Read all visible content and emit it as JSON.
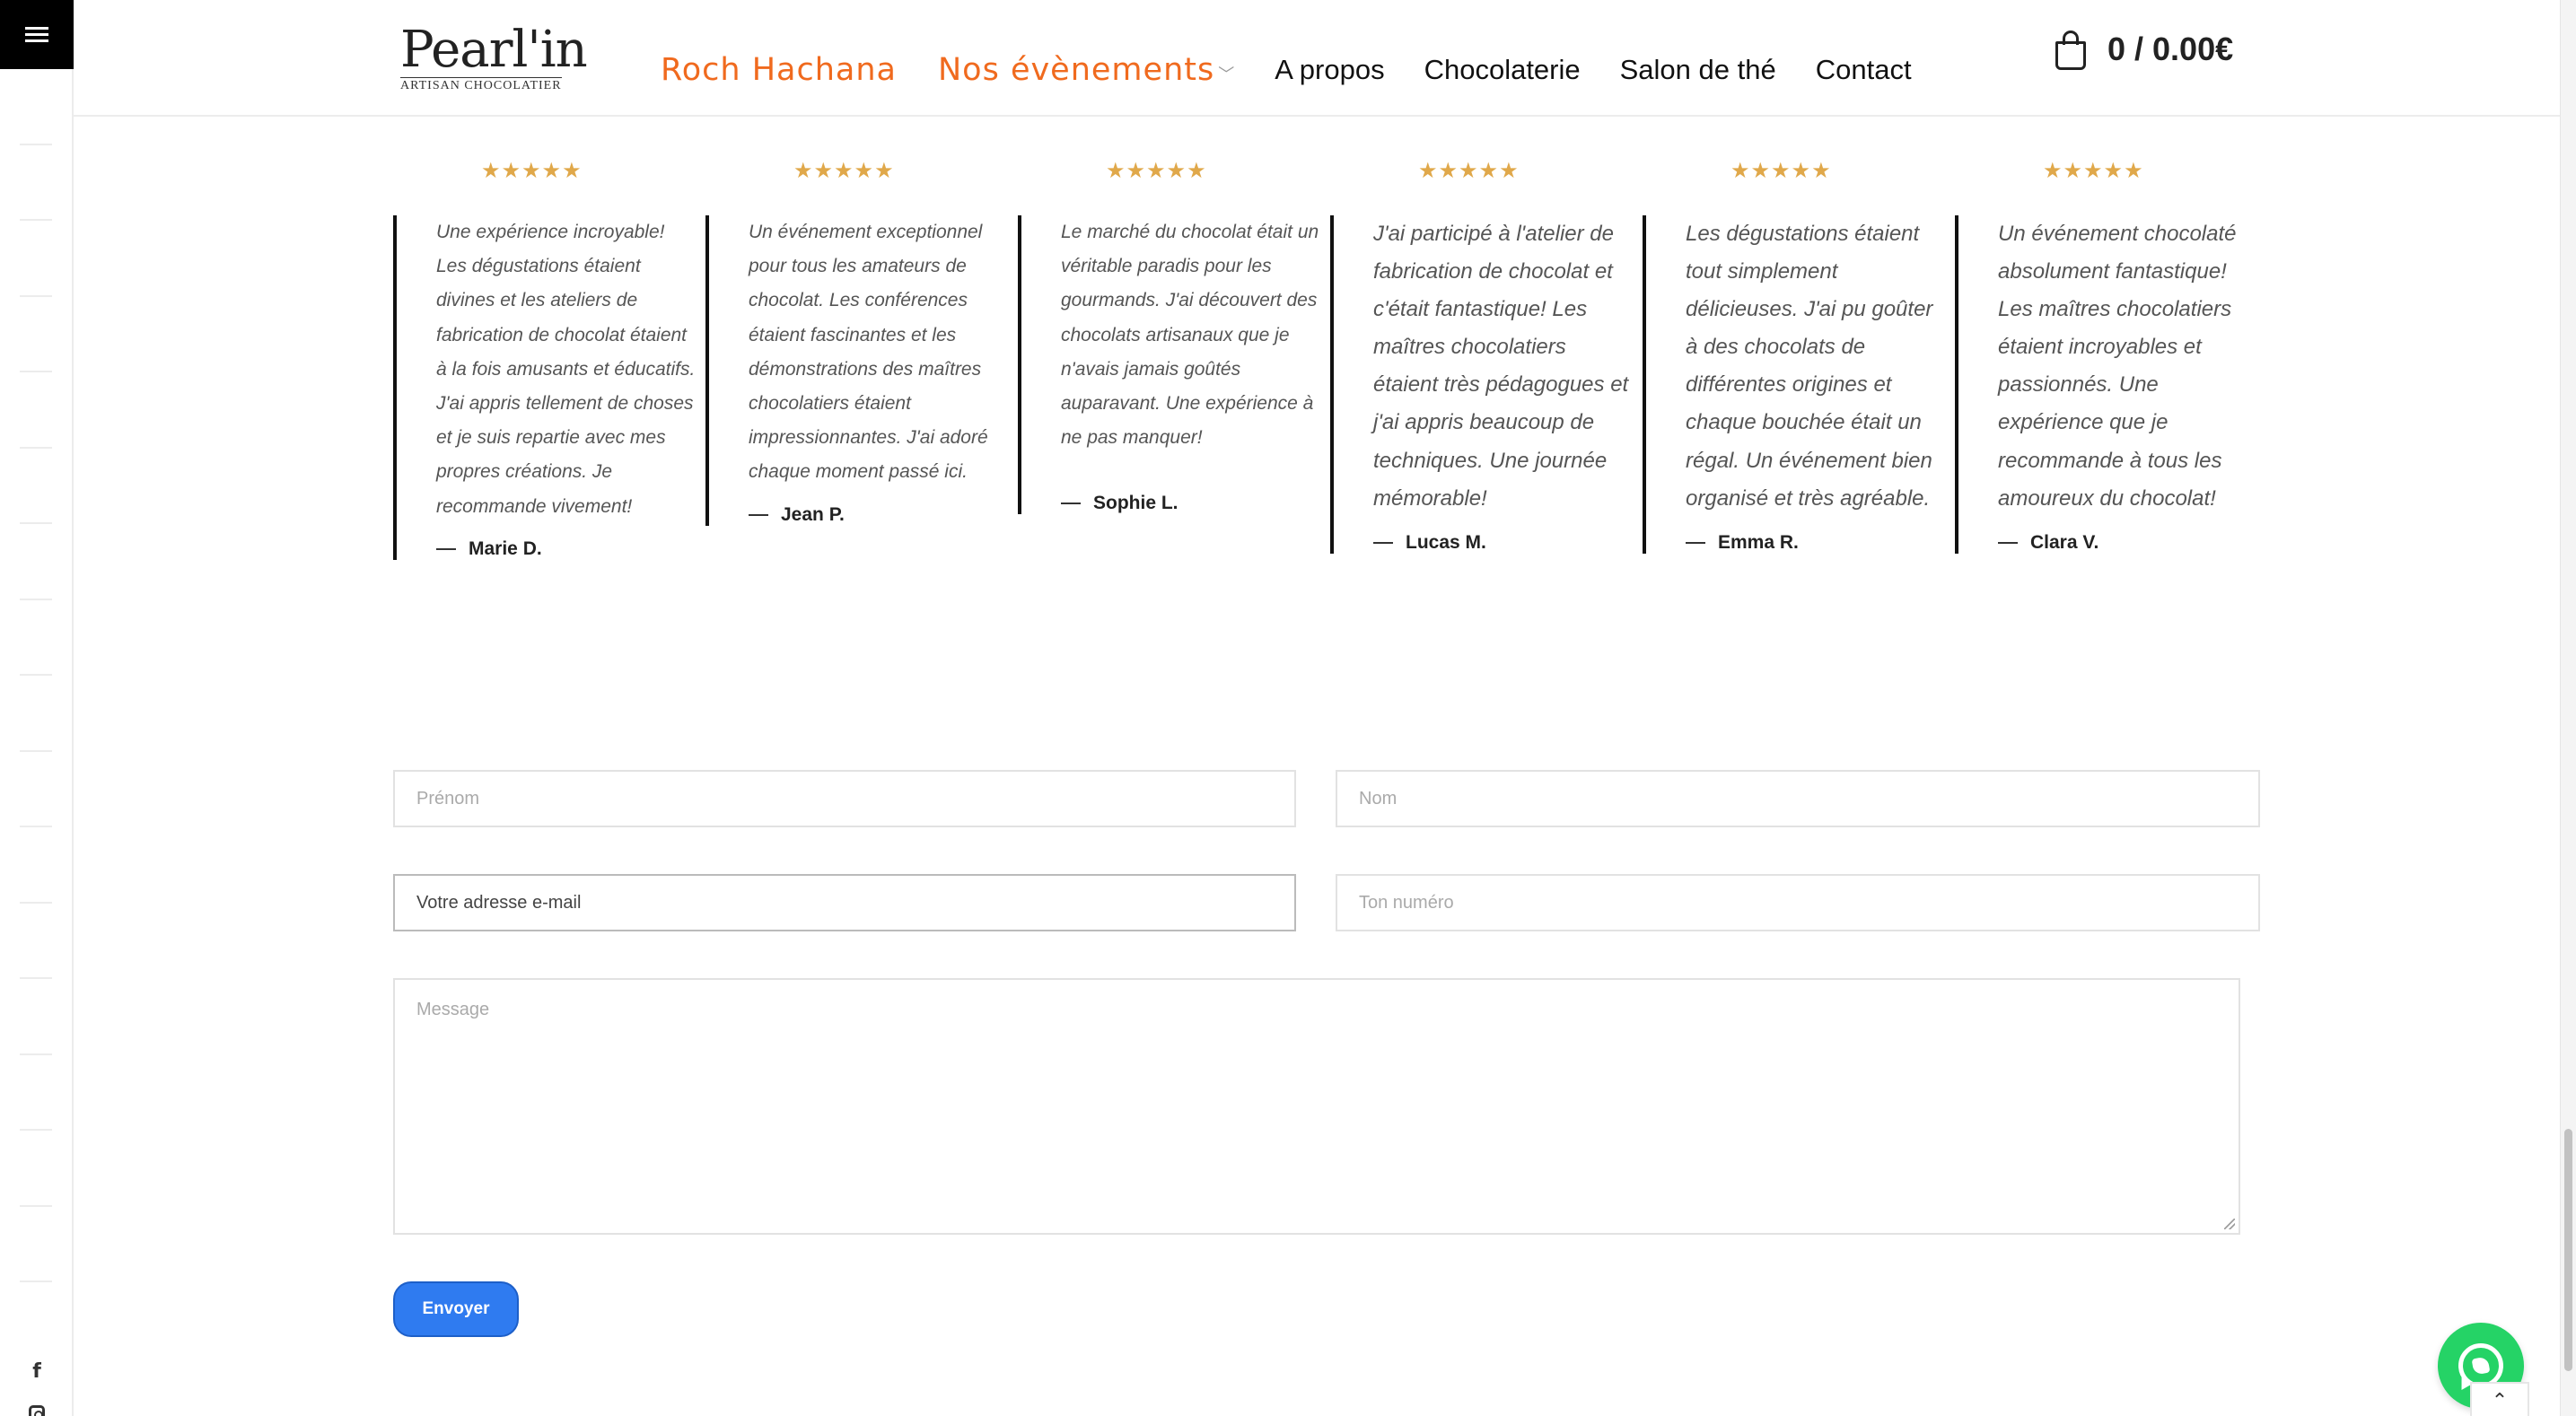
{
  "header": {
    "logo_name": "Pearl'in",
    "logo_sub": "ARTISAN CHOCOLATIER",
    "nav": [
      {
        "label": "Roch Hachana",
        "highlight": true
      },
      {
        "label": "Nos évènements",
        "highlight": true,
        "has_dropdown": true
      },
      {
        "label": "A propos"
      },
      {
        "label": "Chocolaterie"
      },
      {
        "label": "Salon de thé"
      },
      {
        "label": "Contact"
      }
    ],
    "cart": "0 / 0.00€"
  },
  "testimonials": [
    {
      "stars": "★★★★★",
      "text": "Une expérience incroyable! Les dégustations étaient divines et les ateliers de fabrication de chocolat étaient à la fois amusants et éducatifs. J'ai appris tellement de choses et je suis repartie avec mes propres créations. Je recommande vivement!",
      "author": "Marie D."
    },
    {
      "stars": "★★★★★",
      "text": "Un événement exceptionnel pour tous les amateurs de chocolat. Les conférences étaient fascinantes et les démonstrations des maîtres chocolatiers étaient impressionnantes. J'ai adoré chaque moment passé ici.",
      "author": "Jean P."
    },
    {
      "stars": "★★★★★",
      "text": "Le marché du chocolat était un véritable paradis pour les gourmands. J'ai découvert des chocolats artisanaux que je n'avais jamais goûtés auparavant. Une expérience à ne pas manquer!",
      "author": "Sophie L."
    },
    {
      "stars": "★★★★★",
      "text": "J'ai participé à l'atelier de fabrication de chocolat et c'était fantastique! Les maîtres chocolatiers étaient très pédagogues et j'ai appris beaucoup de techniques. Une journée mémorable!",
      "author": "Lucas M."
    },
    {
      "stars": "★★★★★",
      "text": "Les dégustations étaient tout simplement délicieuses. J'ai pu goûter à des chocolats de différentes origines et chaque bouchée était un régal. Un événement bien organisé et très agréable.",
      "author": "Emma R."
    },
    {
      "stars": "★★★★★",
      "text": "Un événement chocolaté absolument fantastique! Les maîtres chocolatiers étaient incroyables et passionnés. Une expérience que je recommande à tous les amoureux du chocolat!",
      "author": "Clara V."
    }
  ],
  "form": {
    "first_name_placeholder": "Prénom",
    "last_name_placeholder": "Nom",
    "email_placeholder": "Votre adresse e-mail",
    "phone_placeholder": "Ton numéro",
    "message_placeholder": "Message",
    "submit_label": "Envoyer"
  },
  "icons": {
    "menu": "hamburger-icon",
    "cart": "shopping-bag-icon",
    "facebook": "facebook-icon",
    "instagram": "instagram-icon",
    "whatsapp": "whatsapp-icon",
    "back_to_top": "chevron-up-icon"
  },
  "colors": {
    "accent": "#f06a1e",
    "stars": "#e0a84a",
    "button": "#2f7bf0",
    "whatsapp": "#25d366"
  },
  "back_to_top_glyph": "⌃"
}
